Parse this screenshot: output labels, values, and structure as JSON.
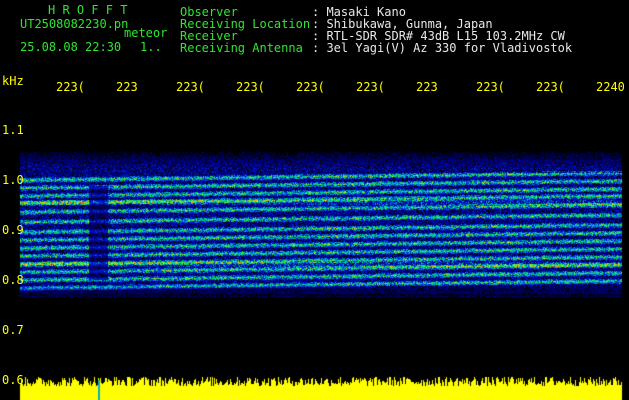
{
  "header": {
    "app_name": "H R O F F T",
    "filename": "UT2508082230.pn",
    "mode_label": "meteor",
    "datetime": "25.08.08 22:30",
    "index": "1..",
    "fields": [
      {
        "label": "Observer",
        "value": ": Masaki Kano"
      },
      {
        "label": "Receiving Location",
        "value": ": Shibukawa, Gunma, Japan"
      },
      {
        "label": "Receiver",
        "value": ": RTL-SDR SDR# 43dB L15 103.2MHz CW"
      },
      {
        "label": "Receiving Antenna",
        "value": ": 3el Yagi(V) Az 330 for Vladivostok"
      }
    ]
  },
  "time_axis": {
    "labels": [
      "223(",
      "223",
      "223(",
      "223(",
      "223(",
      "223(",
      "223",
      "223(",
      "223(",
      "2240"
    ]
  },
  "freq_axis": {
    "unit": "kHz",
    "labels": [
      "1.1",
      "1.0",
      "0.9",
      "0.8",
      "0.7",
      "0.6"
    ]
  },
  "colors": {
    "background": "#000000",
    "axis_text": "#ffff00",
    "header_label": "#2ee62e",
    "header_text": "#e8e8e8",
    "noise_band": "#ffff00"
  }
}
